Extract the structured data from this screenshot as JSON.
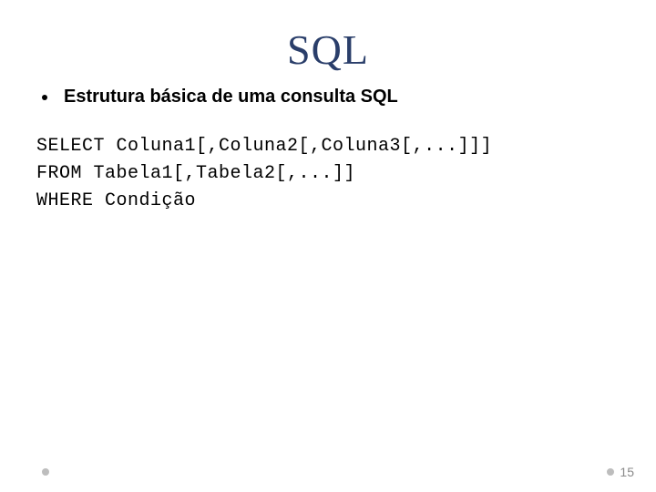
{
  "slide": {
    "title": "SQL",
    "bullet": "Estrutura básica de uma consulta SQL",
    "code": {
      "line1": "SELECT Coluna1[,Coluna2[,Coluna3[,...]]]",
      "line2": "FROM Tabela1[,Tabela2[,...]]",
      "line3": "WHERE Condição"
    },
    "page_number": "15"
  }
}
